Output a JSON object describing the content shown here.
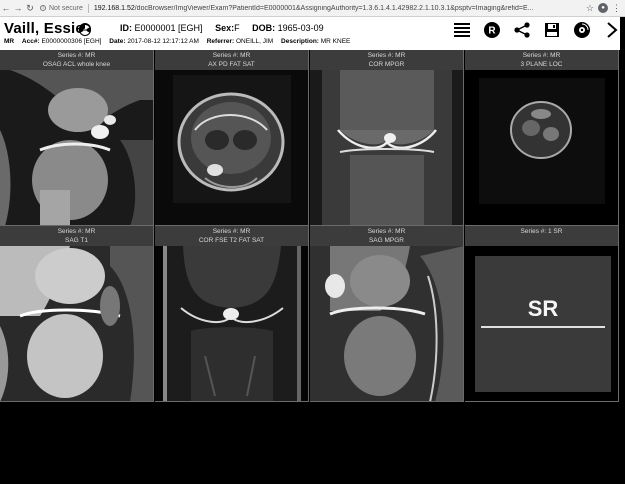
{
  "browser": {
    "security_label": "Not secure",
    "url_host": "192.168.1.52",
    "url_path": "/docBrowser/ImgViewer/Exam?PatientId=E0000001&AssigningAuthority=1.3.6.1.4.1.42982.2.1.10.3.1&psptv=Imaging&refid=E..."
  },
  "patient": {
    "name": "Vaill, Essie",
    "id_label": "ID:",
    "id_value": "E0000001 [EGH]",
    "sex_label": "Sex:",
    "sex_value": "F",
    "dob_label": "DOB:",
    "dob_value": "1965-03-09"
  },
  "exam": {
    "modality": "MR",
    "acc_label": "Acc#:",
    "acc_value": "E0000000306 [EGH]",
    "date_label": "Date:",
    "date_value": "2017-08-12 12:17:12 AM",
    "referrer_label": "Referrer:",
    "referrer_value": "ONEILL, JIM",
    "description_label": "Description:",
    "description_value": "MR KNEE"
  },
  "series": [
    {
      "line1": "Series #: MR",
      "line2": "OSAG ACL whole knee"
    },
    {
      "line1": "Series #: MR",
      "line2": "AX PD FAT SAT"
    },
    {
      "line1": "Series #: MR",
      "line2": "COR MPGR"
    },
    {
      "line1": "Series #: MR",
      "line2": "3 PLANE LOC"
    },
    {
      "line1": "Series #: MR",
      "line2": "SAG T1"
    },
    {
      "line1": "Series #: MR",
      "line2": "COR FSE T2 FAT SAT"
    },
    {
      "line1": "Series #: MR",
      "line2": "SAG MPGR"
    },
    {
      "line1": "Series #: 1 SR",
      "line2": ""
    }
  ],
  "sr_label": "SR",
  "toolbar_icons": [
    "list-icon",
    "r-report-icon",
    "share-icon",
    "save-icon",
    "disc-icon",
    "chevron-right-icon"
  ]
}
